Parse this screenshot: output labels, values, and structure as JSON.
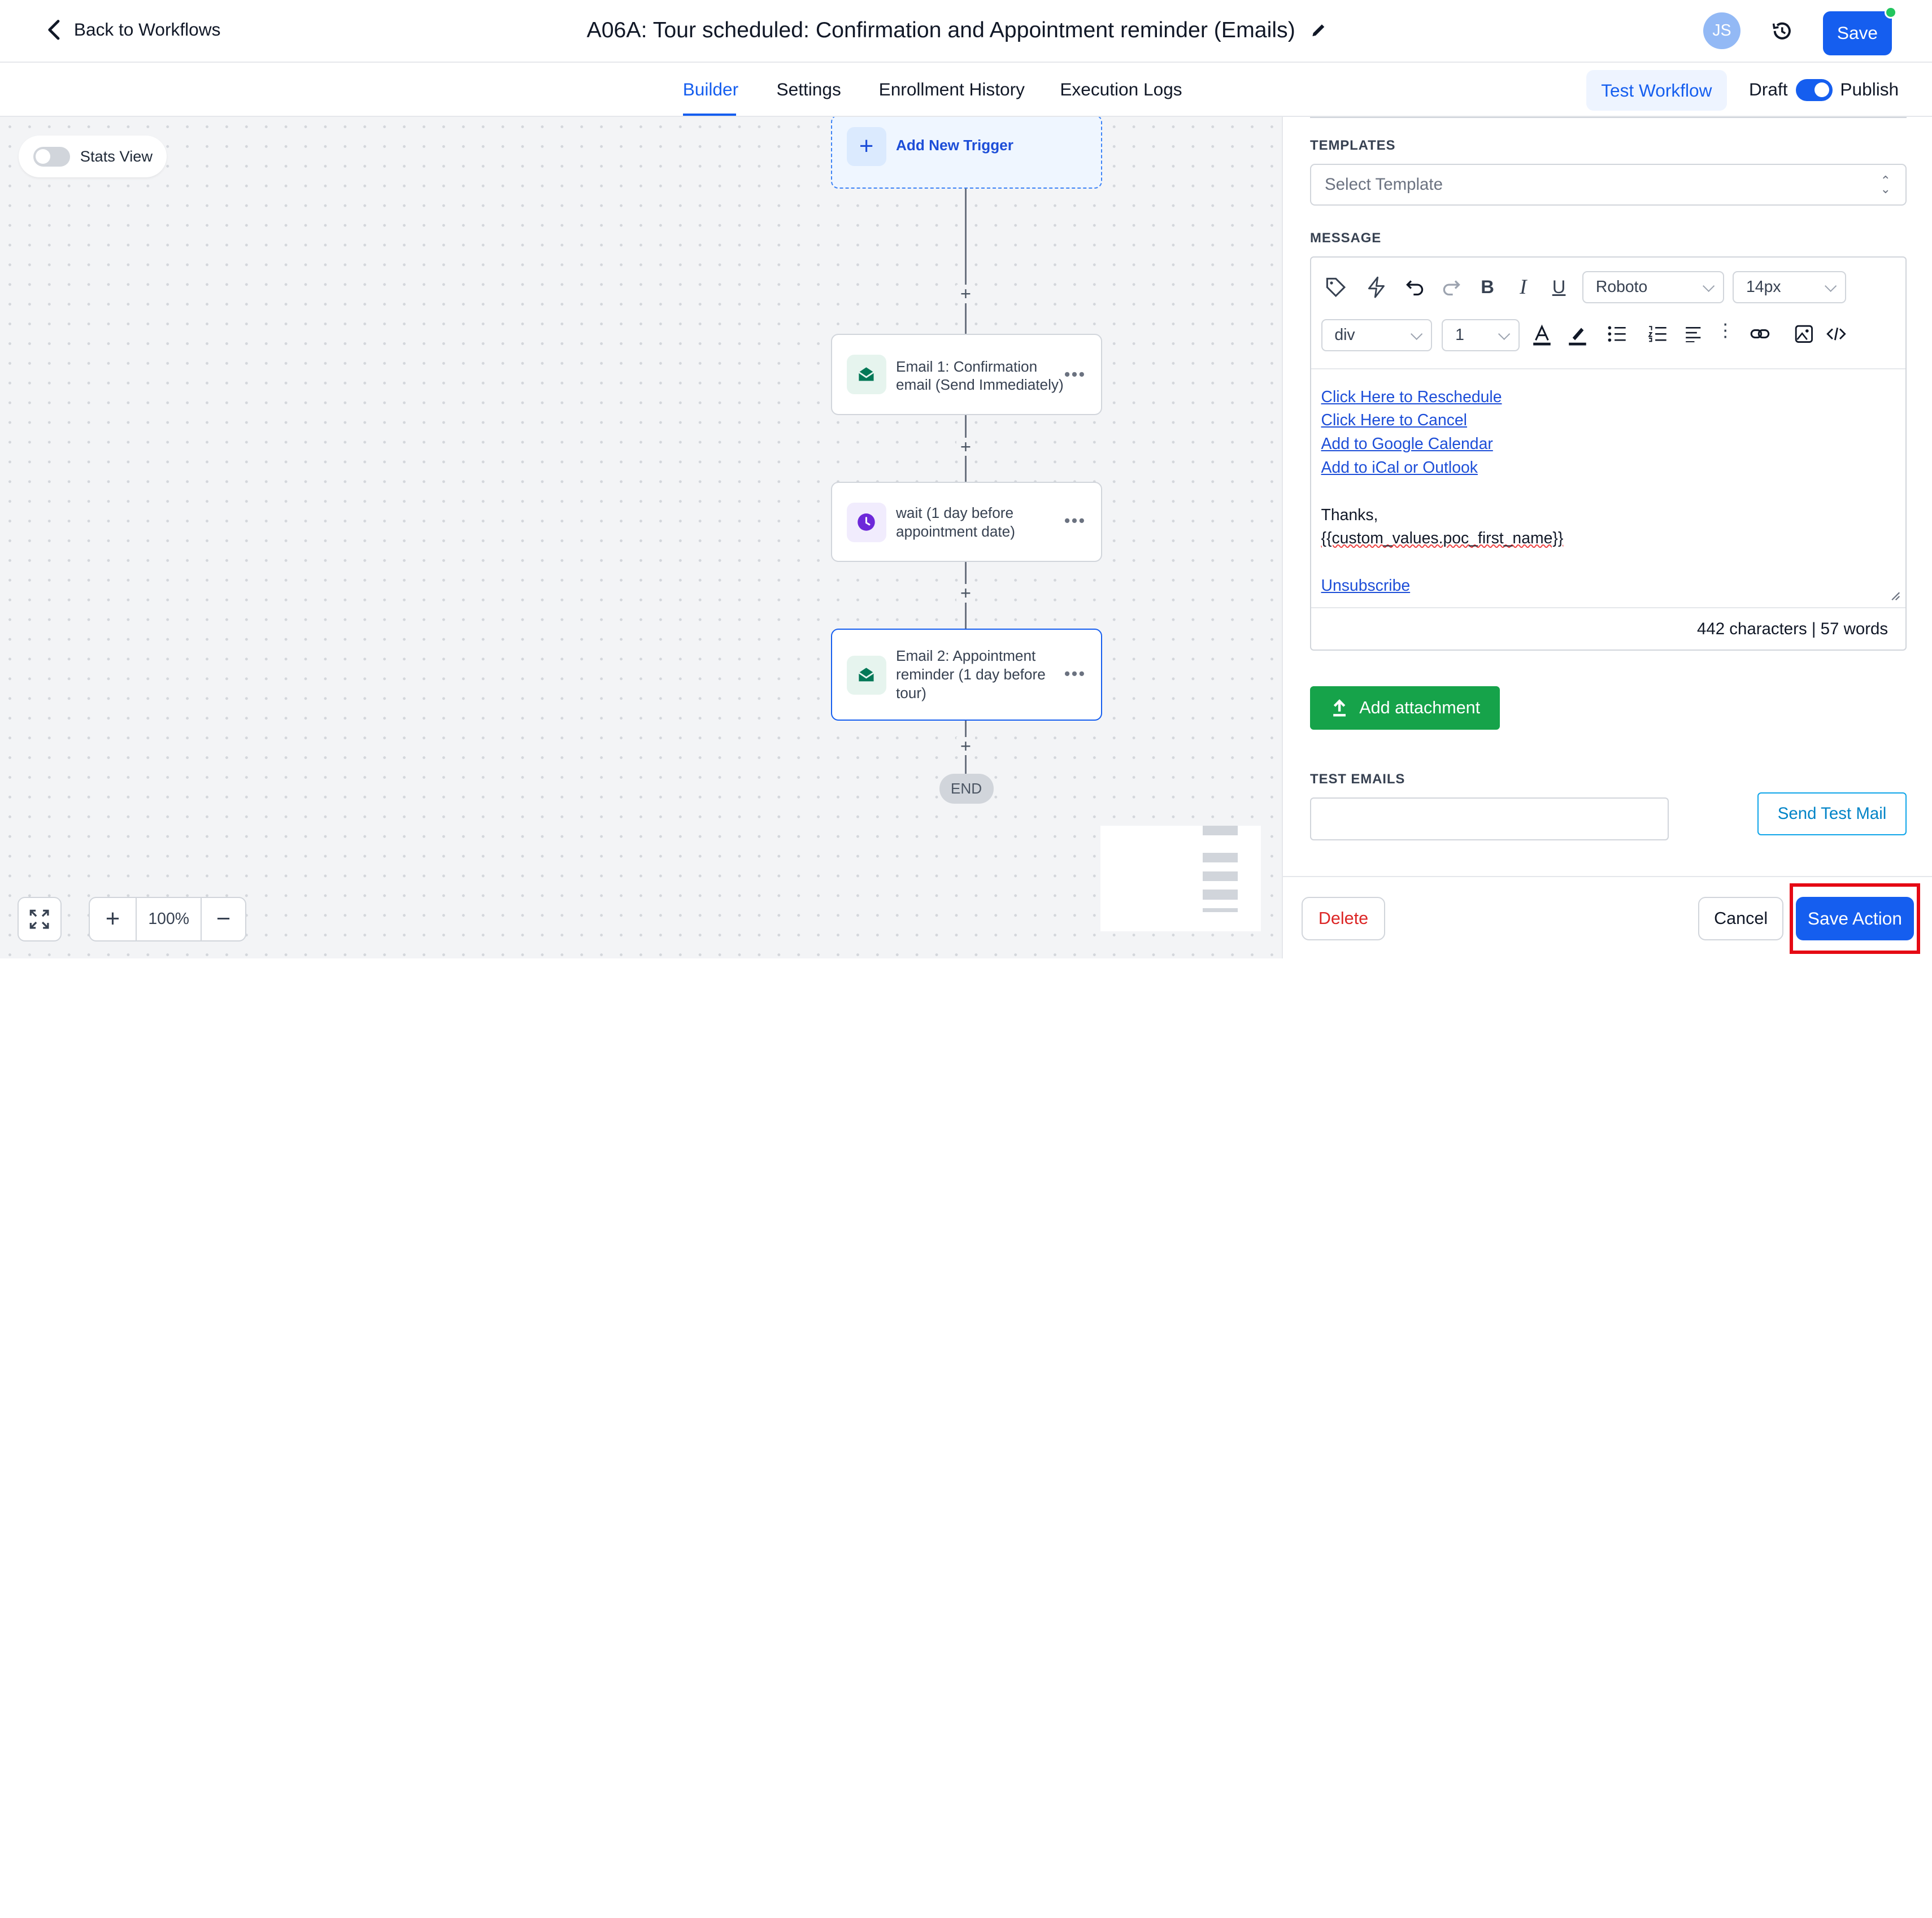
{
  "header": {
    "back_label": "Back to Workflows",
    "title": "A06A: Tour scheduled: Confirmation and Appointment reminder (Emails)",
    "avatar_initials": "JS",
    "save_label": "Save",
    "online_color": "#22c55e"
  },
  "tabs": {
    "items": [
      {
        "label": "Builder",
        "active": true
      },
      {
        "label": "Settings",
        "active": false
      },
      {
        "label": "Enrollment History",
        "active": false
      },
      {
        "label": "Execution Logs",
        "active": false
      }
    ],
    "test_workflow": "Test Workflow",
    "draft_label": "Draft",
    "publish_label": "Publish",
    "publish_on": true
  },
  "canvas": {
    "stats_view_label": "Stats View",
    "stats_view_on": false,
    "trigger_label": "Add New Trigger",
    "nodes": [
      {
        "label": "Email 1: Confirmation email (Send Immediately)",
        "icon": "email-icon"
      },
      {
        "label": "wait (1 day before appointment date)",
        "icon": "clock-icon"
      },
      {
        "label": "Email 2: Appointment reminder (1 day before tour)",
        "icon": "email-icon",
        "selected": true
      }
    ],
    "end_label": "END",
    "plus_symbol": "+",
    "zoom_level": "100%"
  },
  "panel": {
    "templates_label": "TEMPLATES",
    "template_placeholder": "Select Template",
    "message_label": "MESSAGE",
    "toolbar": {
      "font": "Roboto",
      "size": "14px",
      "block": "div",
      "line_height": "1"
    },
    "body": {
      "links": [
        "Click Here to Reschedule",
        "Click Here to Cancel",
        "Add to Google Calendar",
        "Add to iCal or Outlook"
      ],
      "thanks": "Thanks,",
      "signature": "{{custom_values.poc_first_name}}",
      "unsubscribe": "Unsubscribe"
    },
    "counter": "442 characters | 57 words",
    "add_attachment": "Add attachment",
    "test_emails_label": "TEST EMAILS",
    "send_test_mail": "Send Test Mail",
    "delete_label": "Delete",
    "cancel_label": "Cancel",
    "save_action_label": "Save Action",
    "highlight_color": "#e50914"
  }
}
